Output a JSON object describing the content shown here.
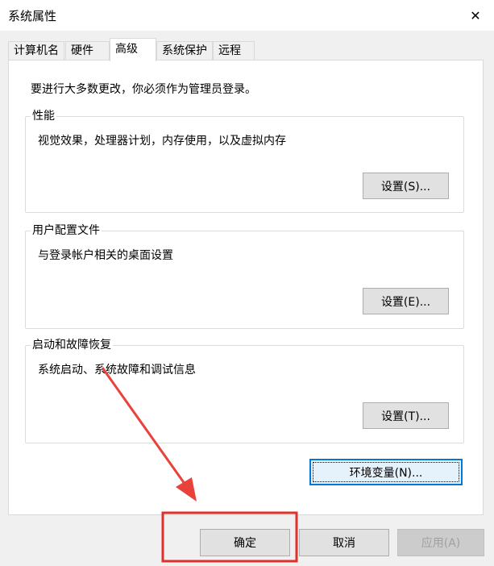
{
  "window": {
    "title": "系统属性",
    "close_glyph": "✕"
  },
  "tabs": [
    {
      "label": "计算机名",
      "active": false
    },
    {
      "label": "硬件",
      "active": false
    },
    {
      "label": "高级",
      "active": true
    },
    {
      "label": "系统保护",
      "active": false
    },
    {
      "label": "远程",
      "active": false
    }
  ],
  "advanced": {
    "admin_note": "要进行大多数更改，你必须作为管理员登录。",
    "performance": {
      "title": "性能",
      "description": "视觉效果，处理器计划，内存使用，以及虚拟内存",
      "button": "设置(S)..."
    },
    "user_profiles": {
      "title": "用户配置文件",
      "description": "与登录帐户相关的桌面设置",
      "button": "设置(E)..."
    },
    "startup_recovery": {
      "title": "启动和故障恢复",
      "description": "系统启动、系统故障和调试信息",
      "button": "设置(T)..."
    },
    "env_vars_button": "环境变量(N)..."
  },
  "footer": {
    "ok": "确定",
    "cancel": "取消",
    "apply": "应用(A)"
  },
  "annotation_colors": {
    "arrow": "#e8423b",
    "box": "#e0302a"
  }
}
